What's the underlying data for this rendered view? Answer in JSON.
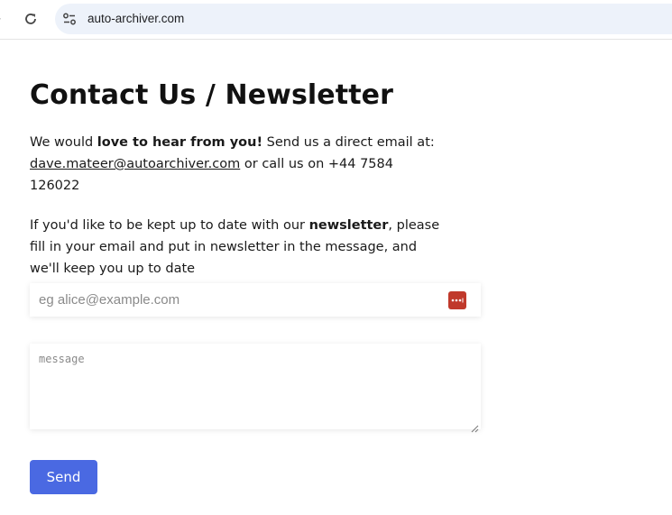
{
  "browser": {
    "url": "auto-archiver.com",
    "back_glyph": "›",
    "icons": [
      "back-arrow-icon",
      "reload-icon",
      "site-info-icon"
    ]
  },
  "page": {
    "title": "Contact Us / Newsletter",
    "intro": {
      "t1": "We would ",
      "b1": "love to hear from you!",
      "t2": " Send us a direct email at: ",
      "email": "dave.mateer@autoarchiver.com",
      "t3": " or call us on +44 7584 126022"
    },
    "newsletter": {
      "t1": "If you'd like to be kept up to date with our ",
      "b1": "newsletter",
      "t2": ", please fill in your email and put in newsletter in the message, and we'll keep you up to date"
    }
  },
  "form": {
    "email_placeholder": "eg alice@example.com",
    "email_value": "",
    "message_placeholder": "message",
    "message_value": "",
    "send_label": "Send",
    "password_manager_icon": "password-manager-icon"
  },
  "colors": {
    "accent": "#4a69e2",
    "omnibox": "#edf2fa",
    "password_icon": "#c0392b"
  }
}
